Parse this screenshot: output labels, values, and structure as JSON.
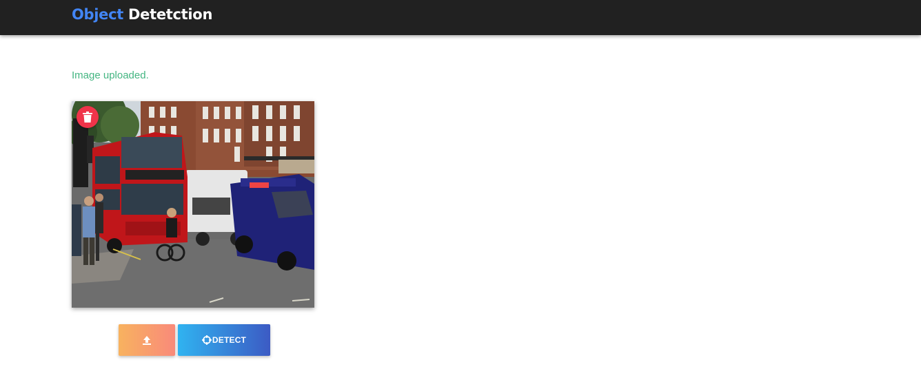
{
  "navbar": {
    "brand_part1": "Object",
    "brand_part2": "Detetction",
    "brand_accent_color": "#4285f4",
    "background_color": "#212121"
  },
  "status": {
    "message": "Image uploaded.",
    "color": "#43b581"
  },
  "preview": {
    "delete_icon": "trash-icon"
  },
  "actions": {
    "upload_icon": "upload-icon",
    "detect_icon": "crosshair-icon",
    "detect_label": "DETECT"
  }
}
